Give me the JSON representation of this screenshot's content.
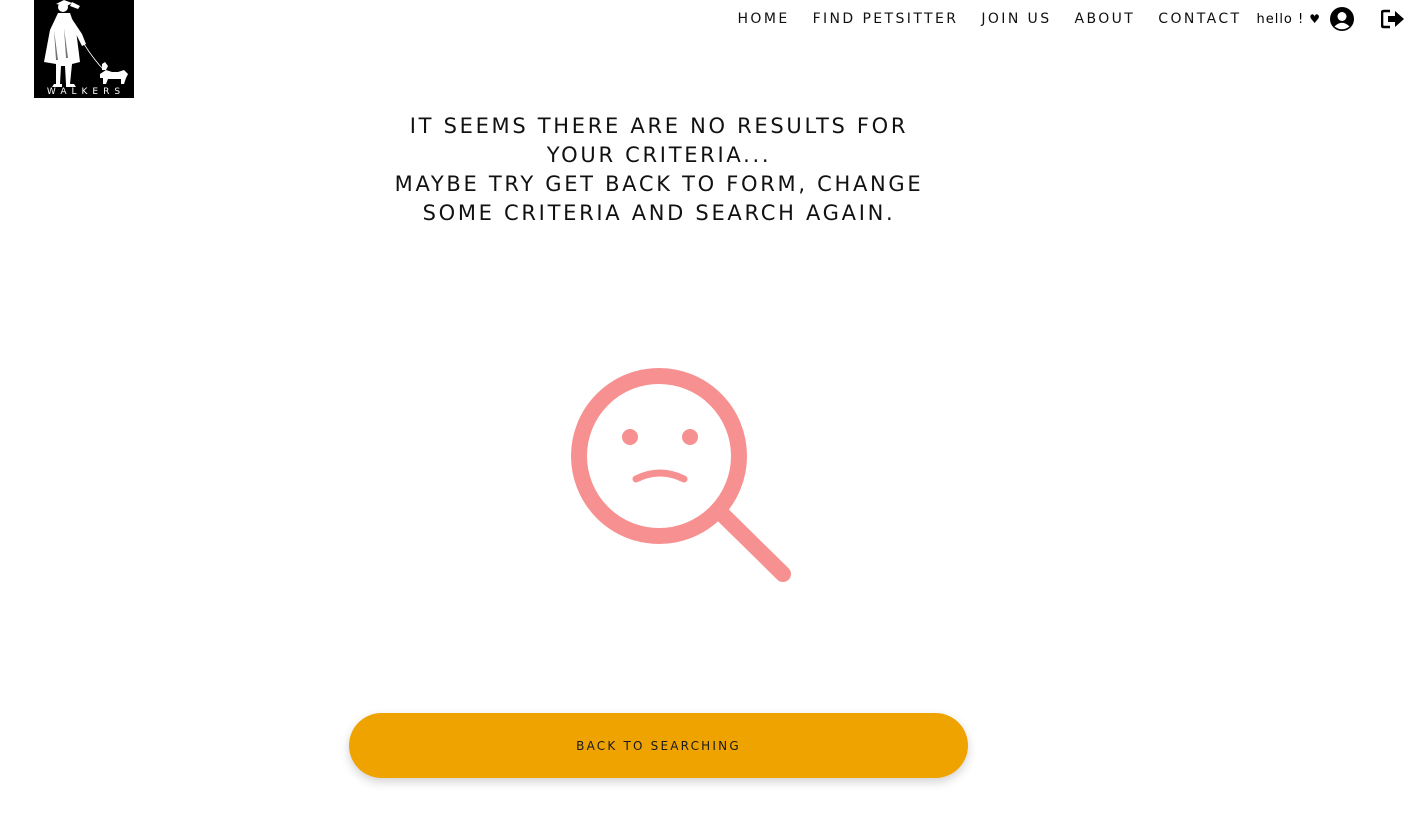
{
  "brand": {
    "logo_text": "WALKERS"
  },
  "nav": {
    "items": [
      "HOME",
      "FIND PETSITTER",
      "JOIN US",
      "ABOUT",
      "CONTACT"
    ],
    "greeting": "hello !",
    "heart": "♥",
    "user_icon": "user-circle-icon",
    "logout_icon": "sign-out-icon"
  },
  "message": {
    "lines": [
      "IT SEEMS THERE ARE NO RESULTS FOR",
      "YOUR CRITERIA...",
      "MAYBE TRY GET BACK TO FORM, CHANGE",
      "SOME CRITERIA AND SEARCH AGAIN."
    ]
  },
  "illustration": {
    "icon": "sad-magnifier-icon",
    "color": "#f79090"
  },
  "button": {
    "label": "BACK TO SEARCHING",
    "color": "#efa300"
  }
}
